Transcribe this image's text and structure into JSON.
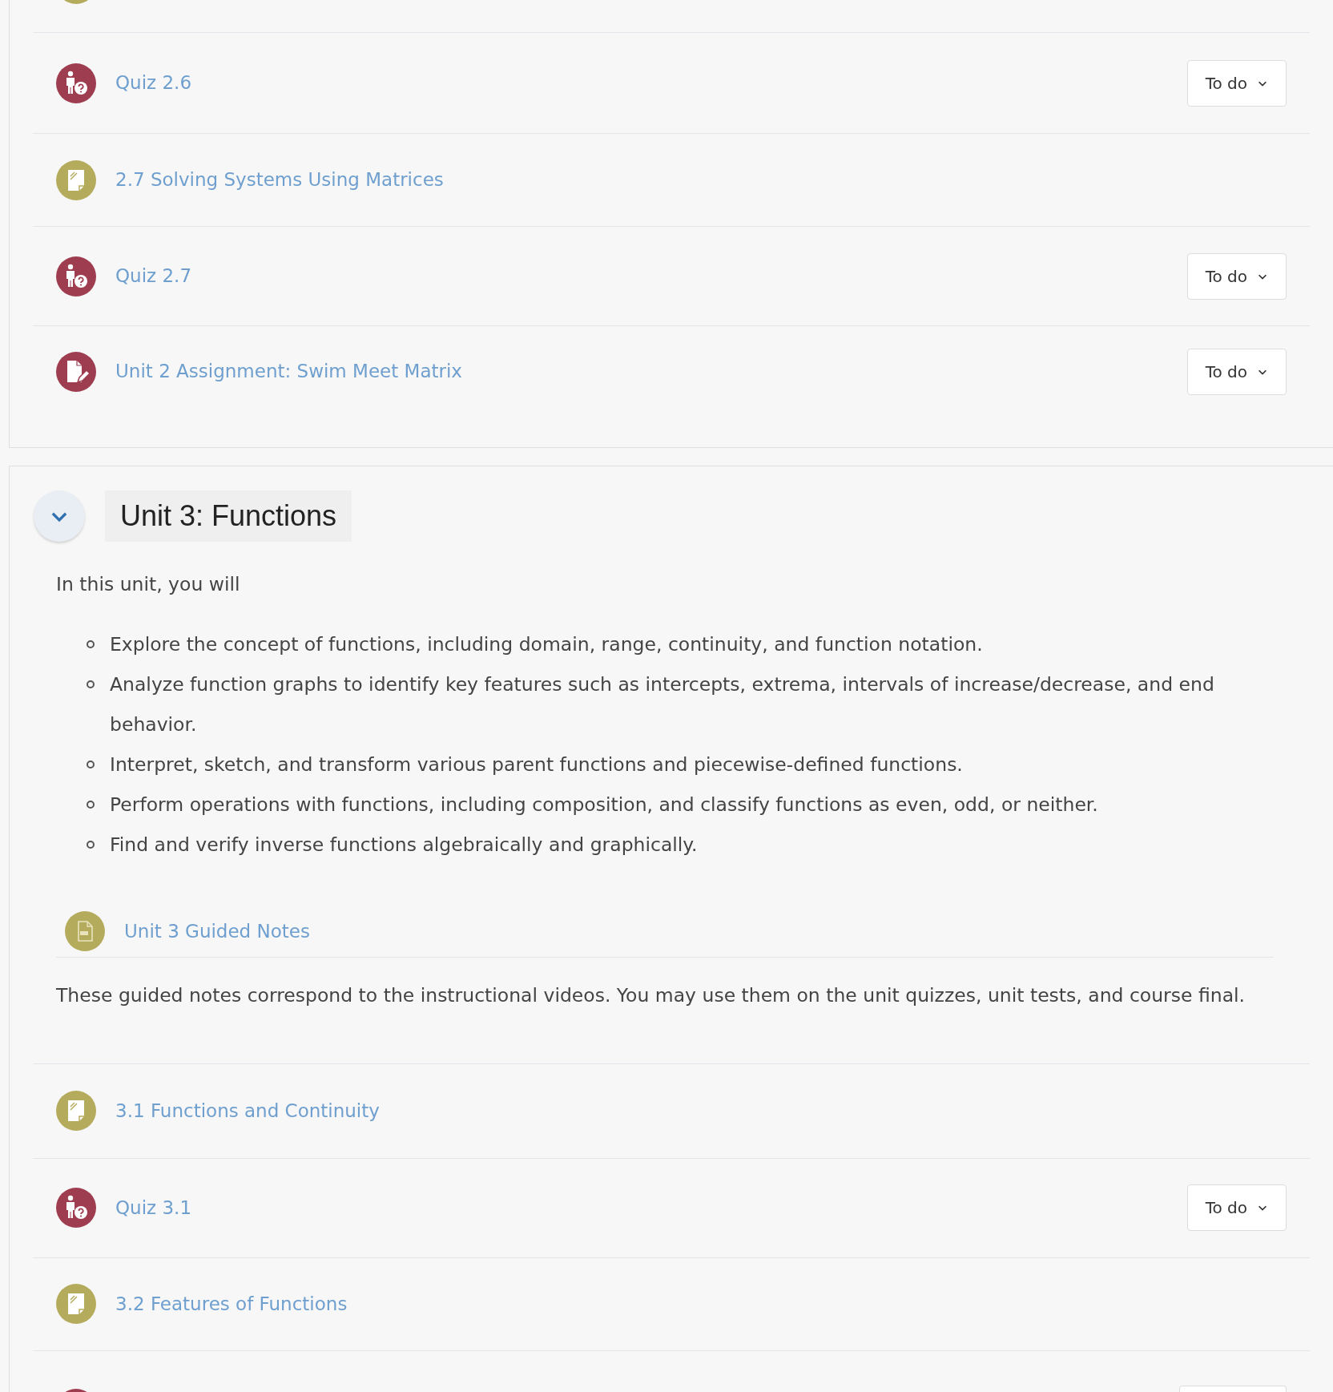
{
  "top_partial_item": {
    "kind": "lesson"
  },
  "sections": [
    {
      "items": [
        {
          "kind": "quiz",
          "title": "Quiz 2.6",
          "status": "To do"
        },
        {
          "kind": "lesson",
          "title": "2.7 Solving Systems Using Matrices"
        },
        {
          "kind": "quiz",
          "title": "Quiz 2.7",
          "status": "To do"
        },
        {
          "kind": "assignment",
          "title": "Unit 2 Assignment: Swim Meet Matrix",
          "status": "To do"
        }
      ]
    },
    {
      "title": "Unit 3: Functions",
      "expanded": true,
      "intro": "In this unit, you will",
      "objectives": [
        "Explore the concept of functions, including domain, range, continuity, and function notation.",
        "Analyze function graphs to identify key features such as intercepts, extrema, intervals of increase/decrease, and end behavior.",
        "Interpret, sketch, and transform various parent functions and piecewise-defined functions.",
        "Perform operations with functions, including composition, and classify functions as even, odd, or neither.",
        "Find and verify inverse functions algebraically and graphically."
      ],
      "resource": {
        "kind": "pdf",
        "title": "Unit 3 Guided Notes",
        "description": "These guided notes correspond to the instructional videos. You may use them on the unit quizzes, unit tests, and course final."
      },
      "items": [
        {
          "kind": "lesson",
          "title": "3.1 Functions and Continuity"
        },
        {
          "kind": "quiz",
          "title": "Quiz 3.1",
          "status": "To do"
        },
        {
          "kind": "lesson",
          "title": "3.2 Features of Functions"
        }
      ]
    }
  ],
  "bottom_partial_item": {
    "kind": "quiz"
  }
}
